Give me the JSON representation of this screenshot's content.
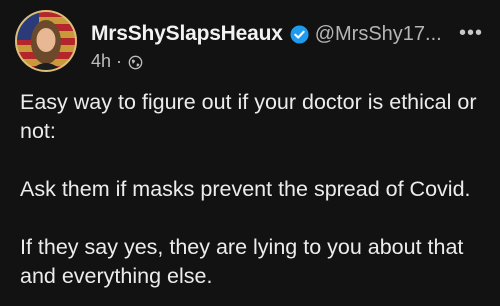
{
  "post": {
    "display_name": "MrsShySlapsHeaux",
    "handle": "@MrsShy17...",
    "timestamp": "4h",
    "separator": "·",
    "more_label": "•••",
    "paragraphs": [
      "Easy way to figure out if your doctor is ethical or not:",
      "Ask them if masks prevent the spread of Covid.",
      "If they say yes, they are lying to you about that and everything else."
    ],
    "icons": {
      "verified": "verified-badge-icon",
      "visibility": "globe-icon",
      "more": "more-options-icon"
    },
    "colors": {
      "background": "#121212",
      "verified": "#1d9bf0",
      "text": "#ececec",
      "muted": "#b5b5b5"
    }
  }
}
